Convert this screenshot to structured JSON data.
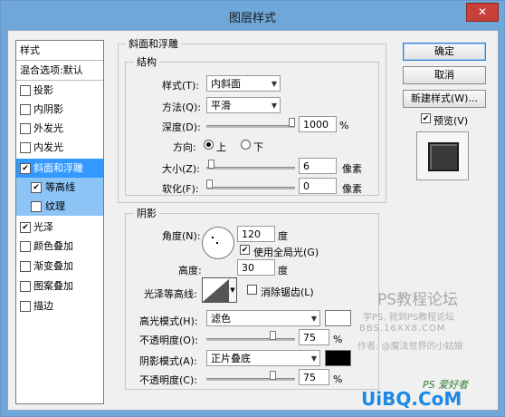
{
  "window": {
    "title": "图层样式",
    "close_glyph": "✕"
  },
  "left_list": {
    "header": "样式",
    "blend_options": "混合选项:默认",
    "items": [
      {
        "label": "投影",
        "checked": false
      },
      {
        "label": "内阴影",
        "checked": false
      },
      {
        "label": "外发光",
        "checked": false
      },
      {
        "label": "内发光",
        "checked": false
      },
      {
        "label": "斜面和浮雕",
        "checked": true
      },
      {
        "label": "等高线",
        "checked": true
      },
      {
        "label": "纹理",
        "checked": false
      },
      {
        "label": "光泽",
        "checked": true
      },
      {
        "label": "颜色叠加",
        "checked": false
      },
      {
        "label": "渐变叠加",
        "checked": false
      },
      {
        "label": "图案叠加",
        "checked": false
      },
      {
        "label": "描边",
        "checked": false
      }
    ]
  },
  "bevel": {
    "group_title": "斜面和浮雕",
    "structure_title": "结构",
    "style_label": "样式(T):",
    "style_value": "内斜面",
    "technique_label": "方法(Q):",
    "technique_value": "平滑",
    "depth_label": "深度(D):",
    "depth_value": "1000",
    "depth_unit": "%",
    "direction_label": "方向:",
    "dir_up": "上",
    "dir_down": "下",
    "size_label": "大小(Z):",
    "size_value": "6",
    "size_unit": "像素",
    "soften_label": "软化(F):",
    "soften_value": "0",
    "soften_unit": "像素"
  },
  "shading": {
    "title": "阴影",
    "angle_label": "角度(N):",
    "angle_value": "120",
    "angle_unit": "度",
    "global_light_label": "使用全局光(G)",
    "altitude_label": "高度:",
    "altitude_value": "30",
    "altitude_unit": "度",
    "gloss_contour_label": "光泽等高线:",
    "anti_alias_label": "消除锯齿(L)",
    "highlight_mode_label": "高光模式(H):",
    "highlight_mode_value": "滤色",
    "highlight_color": "#ffffff",
    "highlight_opacity_label": "不透明度(O):",
    "highlight_opacity_value": "75",
    "opacity_unit": "%",
    "shadow_mode_label": "阴影模式(A):",
    "shadow_mode_value": "正片叠底",
    "shadow_color": "#000000",
    "shadow_opacity_label": "不透明度(C):",
    "shadow_opacity_value": "75"
  },
  "buttons": {
    "ok": "确定",
    "cancel": "取消",
    "new_style": "新建样式(W)...",
    "preview_label": "预览(V)"
  },
  "watermark": {
    "line1": "PS教程论坛",
    "line2": "学PS, 就到PS教程论坛",
    "line3": "BBS.16XX8.COM",
    "line4": "作者: @魔法世界的小姑娘",
    "logo": "UiBQ.CoM",
    "logo_sub": "PS 爱好者"
  }
}
